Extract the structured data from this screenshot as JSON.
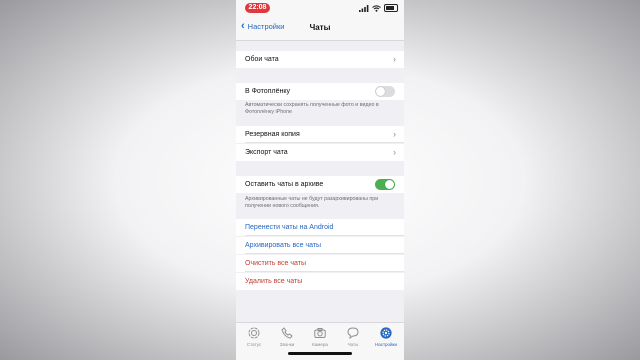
{
  "status": {
    "time": "22:08"
  },
  "nav": {
    "back_label": "Настройки",
    "title": "Чаты"
  },
  "rows": {
    "wallpaper": "Обои чата",
    "camera_roll": "В Фотоплёнку",
    "camera_roll_note": "Автоматически сохранять полученные фото и видео в Фотоплёнку iPhone",
    "backup": "Резервная копия",
    "export": "Экспорт чата",
    "keep_archived": "Оставить чаты в архиве",
    "keep_archived_note": "Архивированные чаты не будут разархивированы при получении нового сообщения."
  },
  "toggles": {
    "camera_roll": false,
    "keep_archived": true
  },
  "actions": {
    "move_android": "Перенести чаты на Android",
    "archive_all": "Архивировать все чаты",
    "clear_all": "Очистить все чаты",
    "delete_all": "Удалить все чаты"
  },
  "tabs": [
    {
      "label": "Статус",
      "icon": "status-icon"
    },
    {
      "label": "Звонки",
      "icon": "phone-icon"
    },
    {
      "label": "Камера",
      "icon": "camera-icon"
    },
    {
      "label": "Чаты",
      "icon": "chats-icon"
    },
    {
      "label": "Настройки",
      "icon": "settings-icon",
      "active": true
    }
  ],
  "colors": {
    "accent": "#2467c4",
    "danger": "#c43c31",
    "toggle_on": "#4cb050",
    "time_pill": "#e0383e"
  }
}
